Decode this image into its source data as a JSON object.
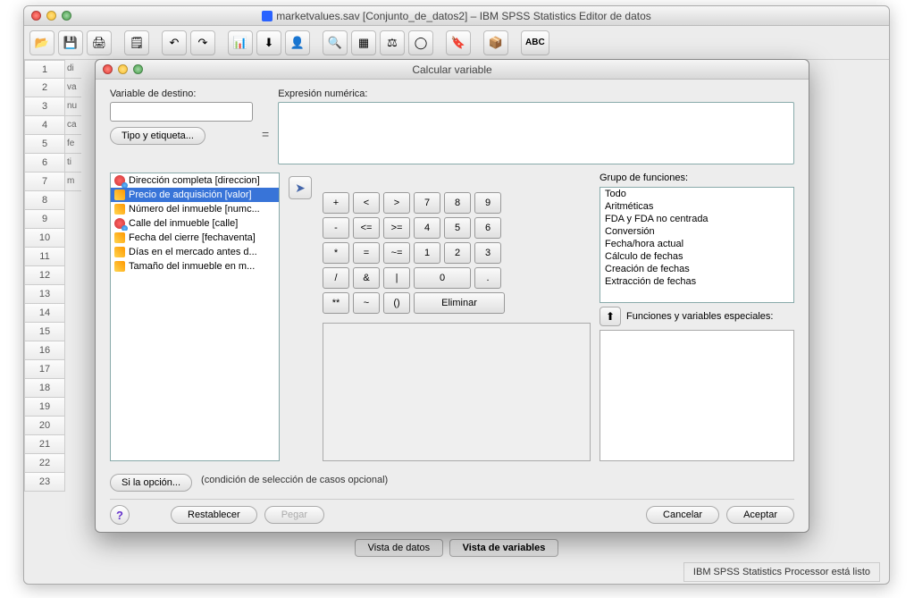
{
  "main_window": {
    "title": "marketvalues.sav [Conjunto_de_datos2] – IBM SPSS Statistics Editor de datos",
    "status": "IBM SPSS Statistics Processor está listo",
    "view_tabs": {
      "data": "Vista de datos",
      "vars": "Vista de variables"
    },
    "rows": [
      "1",
      "2",
      "3",
      "4",
      "5",
      "6",
      "7",
      "8",
      "9",
      "10",
      "11",
      "12",
      "13",
      "14",
      "15",
      "16",
      "17",
      "18",
      "19",
      "20",
      "21",
      "22",
      "23"
    ],
    "peek": [
      "di",
      "va",
      "nu",
      "ca",
      "fe",
      "ti",
      "m"
    ]
  },
  "dialog": {
    "title": "Calcular variable",
    "labels": {
      "target": "Variable de destino:",
      "expr": "Expresión numérica:",
      "type": "Tipo y etiqueta...",
      "fngroup": "Grupo de funciones:",
      "fnspecial": "Funciones y variables especiales:",
      "if_button": "Si la opción...",
      "if_text": "(condición de selección de casos opcional)"
    },
    "target_value": "",
    "expr_value": "",
    "variables": [
      {
        "icon": "nominal",
        "label": "Dirección completa [direccion]"
      },
      {
        "icon": "ruler",
        "label": "Precio de adquisición [valor]",
        "selected": true
      },
      {
        "icon": "ruler",
        "label": "Número del inmueble [numc..."
      },
      {
        "icon": "nominal",
        "label": "Calle del inmueble [calle]"
      },
      {
        "icon": "ruler",
        "label": "Fecha del cierre [fechaventa]"
      },
      {
        "icon": "ruler",
        "label": "Días en el mercado antes d..."
      },
      {
        "icon": "ruler",
        "label": "Tamaño del inmueble en m..."
      }
    ],
    "keypad": {
      "r1": [
        "+",
        "<",
        ">",
        "7",
        "8",
        "9"
      ],
      "r2": [
        "-",
        "<=",
        ">=",
        "4",
        "5",
        "6"
      ],
      "r3": [
        "*",
        "=",
        "~=",
        "1",
        "2",
        "3"
      ],
      "r4": [
        "/",
        "&",
        "|",
        "0",
        "."
      ],
      "r5": [
        "**",
        "~",
        "()"
      ],
      "eliminar": "Eliminar"
    },
    "fngroups": [
      "Todo",
      "Aritméticas",
      "FDA y FDA no centrada",
      "Conversión",
      "Fecha/hora actual",
      "Cálculo de fechas",
      "Creación de fechas",
      "Extracción de fechas"
    ],
    "buttons": {
      "reset": "Restablecer",
      "paste": "Pegar",
      "cancel": "Cancelar",
      "ok": "Aceptar"
    },
    "eq": "="
  }
}
